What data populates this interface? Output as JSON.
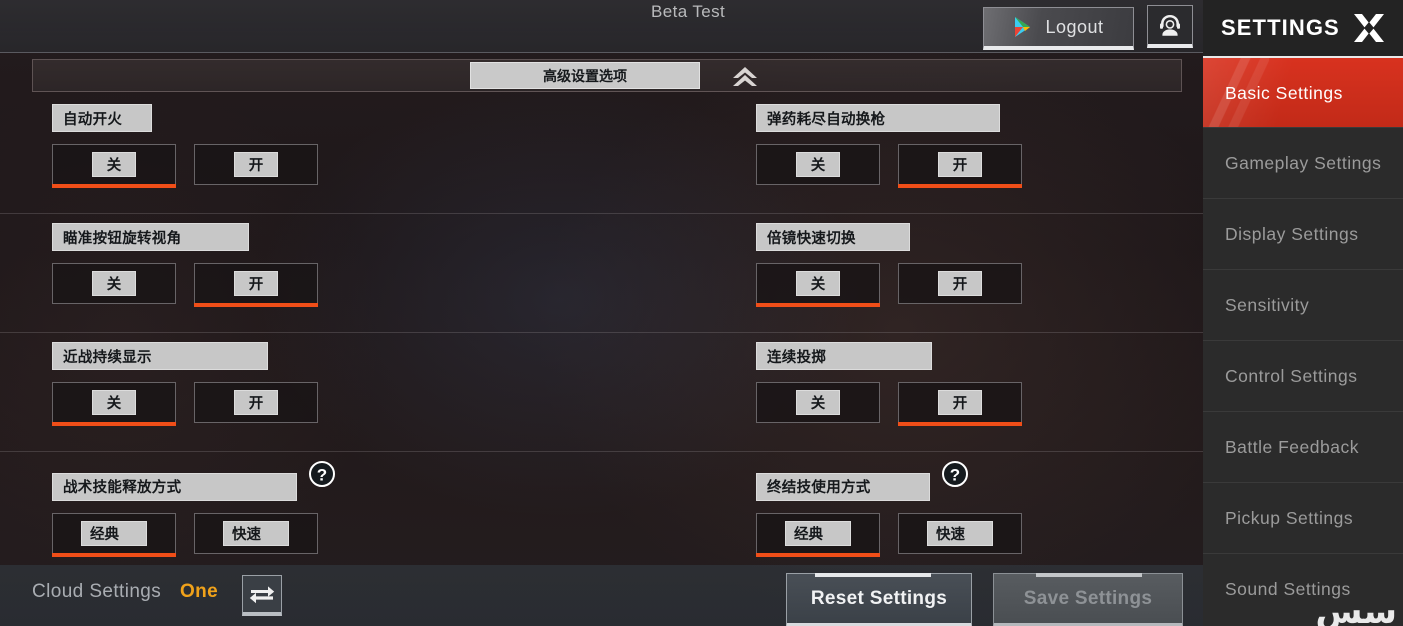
{
  "header": {
    "beta_title": "Beta Test",
    "logout_label": "Logout",
    "play_icon": "google-play-triangle-icon",
    "support_icon": "headset-support-icon"
  },
  "advanced_bar": {
    "label": "高级设置选项",
    "collapse_icon": "double-chevron-up-icon"
  },
  "settings_rows": [
    {
      "left": {
        "label": "自动开火",
        "label_width": 100,
        "has_help": false,
        "options": [
          {
            "text": "关",
            "selected": true
          },
          {
            "text": "开",
            "selected": false
          }
        ]
      },
      "right": {
        "label": "弹药耗尽自动换枪",
        "label_width": 244,
        "has_help": false,
        "options": [
          {
            "text": "关",
            "selected": false
          },
          {
            "text": "开",
            "selected": true
          }
        ]
      }
    },
    {
      "left": {
        "label": "瞄准按钮旋转视角",
        "label_width": 197,
        "has_help": false,
        "options": [
          {
            "text": "关",
            "selected": false
          },
          {
            "text": "开",
            "selected": true
          }
        ]
      },
      "right": {
        "label": "倍镜快速切换",
        "label_width": 154,
        "has_help": false,
        "options": [
          {
            "text": "关",
            "selected": true
          },
          {
            "text": "开",
            "selected": false
          }
        ]
      }
    },
    {
      "left": {
        "label": "近战持续显示",
        "label_width": 216,
        "has_help": false,
        "options": [
          {
            "text": "关",
            "selected": true
          },
          {
            "text": "开",
            "selected": false
          }
        ]
      },
      "right": {
        "label": "连续投掷",
        "label_width": 176,
        "has_help": false,
        "options": [
          {
            "text": "关",
            "selected": false
          },
          {
            "text": "开",
            "selected": true
          }
        ]
      }
    },
    {
      "left": {
        "label": "战术技能释放方式",
        "label_width": 245,
        "has_help": true,
        "help_icon": "question-mark-help-icon",
        "options": [
          {
            "text": "经典",
            "selected": true,
            "wide": true
          },
          {
            "text": "快速",
            "selected": false,
            "wide": true
          }
        ]
      },
      "right": {
        "label": "终结技使用方式",
        "label_width": 174,
        "has_help": true,
        "help_icon": "question-mark-help-icon",
        "options": [
          {
            "text": "经典",
            "selected": true,
            "wide": true
          },
          {
            "text": "快速",
            "selected": false,
            "wide": true
          }
        ]
      }
    }
  ],
  "bottom_bar": {
    "cloud_label": "Cloud Settings",
    "cloud_value": "One",
    "swap_icon": "swap-arrows-icon",
    "reset_label": "Reset Settings",
    "save_label": "Save Settings",
    "save_disabled": true
  },
  "sidebar": {
    "title": "SETTINGS",
    "close_icon": "close-x-icon",
    "items": [
      {
        "label": "Basic Settings",
        "active": true
      },
      {
        "label": "Gameplay Settings",
        "active": false
      },
      {
        "label": "Display Settings",
        "active": false
      },
      {
        "label": "Sensitivity",
        "active": false
      },
      {
        "label": "Control Settings",
        "active": false
      },
      {
        "label": "Battle Feedback",
        "active": false
      },
      {
        "label": "Pickup Settings",
        "active": false
      },
      {
        "label": "Sound Settings",
        "active": false
      }
    ]
  },
  "watermark": {
    "text": "سس"
  },
  "colors": {
    "accent_orange": "#f04e18",
    "active_red": "#d8321f",
    "cloud_value_gold": "#f0a21a",
    "label_gray": "#c7c7c7"
  }
}
